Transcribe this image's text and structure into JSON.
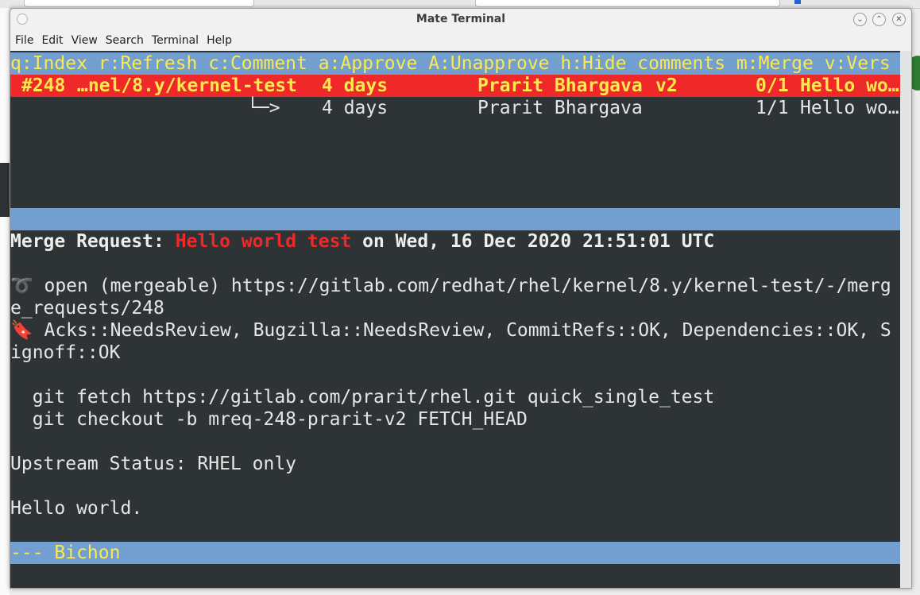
{
  "window": {
    "title": "Mate Terminal"
  },
  "menubar": [
    "File",
    "Edit",
    "View",
    "Search",
    "Terminal",
    "Help"
  ],
  "terminal": {
    "help_line": "q:Index r:Refresh c:Comment a:Approve A:Unapprove h:Hide comments m:Merge v:Vers",
    "mr_list": {
      "selected": {
        "id": "#248",
        "branch": "…nel/8.y/kernel-test",
        "age": "4 days",
        "author": "Prarit Bhargava",
        "version": "v2",
        "progress": "0/1",
        "subject": "Hello wo…"
      },
      "child": {
        "arrow": "└─>",
        "age": "4 days",
        "author": "Prarit Bhargava",
        "progress": "1/1",
        "subject": "Hello wo…"
      }
    },
    "detail": {
      "header_label": "Merge Request: ",
      "header_title": "Hello world test",
      "header_date": " on Wed, 16 Dec 2020 21:51:01 UTC",
      "state_icon": "➰",
      "state_line_1": " open (mergeable) https://gitlab.com/redhat/rhel/kernel/8.y/kernel-test/-/merg",
      "state_line_2": "e_requests/248",
      "labels_icon": "🔖",
      "labels_line_1": " Acks::NeedsReview, Bugzilla::NeedsReview, CommitRefs::OK, Dependencies::OK, S",
      "labels_line_2": "ignoff::OK",
      "git_fetch": "  git fetch https://gitlab.com/prarit/rhel.git quick_single_test",
      "git_checkout": "  git checkout -b mreq-248-prarit-v2 FETCH_HEAD",
      "upstream_status": "Upstream Status: RHEL only",
      "description": "Hello world."
    },
    "status_bar": "--- Bichon"
  }
}
